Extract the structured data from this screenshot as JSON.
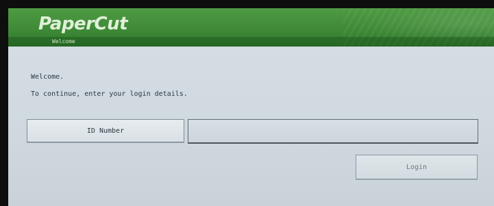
{
  "header": {
    "logo_text": "PaperCut",
    "subtitle": "Welcome"
  },
  "main": {
    "greeting": "Welcome.",
    "instruction": "To continue, enter your login details.",
    "id_label": "ID Number",
    "id_value": "",
    "login_label": "Login"
  },
  "colors": {
    "header_green": "#3f8a37",
    "panel_bg": "#cfd9df",
    "text": "#2b3640"
  }
}
